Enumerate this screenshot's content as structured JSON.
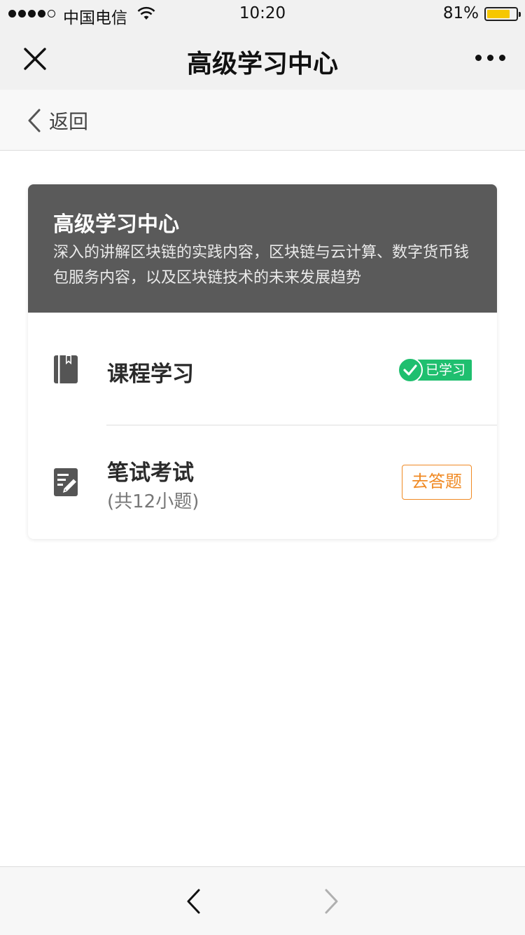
{
  "status_bar": {
    "carrier": "中国电信",
    "time": "10:20",
    "battery_percent": "81%",
    "battery_level": 0.81,
    "signal_bars_filled": 4,
    "signal_bars_total": 5
  },
  "nav": {
    "title": "高级学习中心",
    "close_icon": "close-icon",
    "more_icon": "more-dots-icon"
  },
  "back_bar": {
    "label": "返回"
  },
  "card": {
    "title": "高级学习中心",
    "description": "深入的讲解区块链的实践内容，区块链与云计算、数字货币钱包服务内容，以及区块链技术的未来发展趋势",
    "items": [
      {
        "icon": "book-icon",
        "title": "课程学习",
        "status": "已学习",
        "status_color": "#1fbf6f"
      },
      {
        "icon": "exam-icon",
        "title": "笔试考试",
        "subtitle": "(共12小题)",
        "action": "去答题",
        "action_color": "#f08a24"
      }
    ]
  },
  "toolbar": {
    "back_icon": "chevron-left-icon",
    "forward_icon": "chevron-right-icon"
  },
  "colors": {
    "header_bg": "#5a5a5a",
    "accent_green": "#1fbf6f",
    "accent_orange": "#f08a24",
    "battery": "#f6c700"
  }
}
